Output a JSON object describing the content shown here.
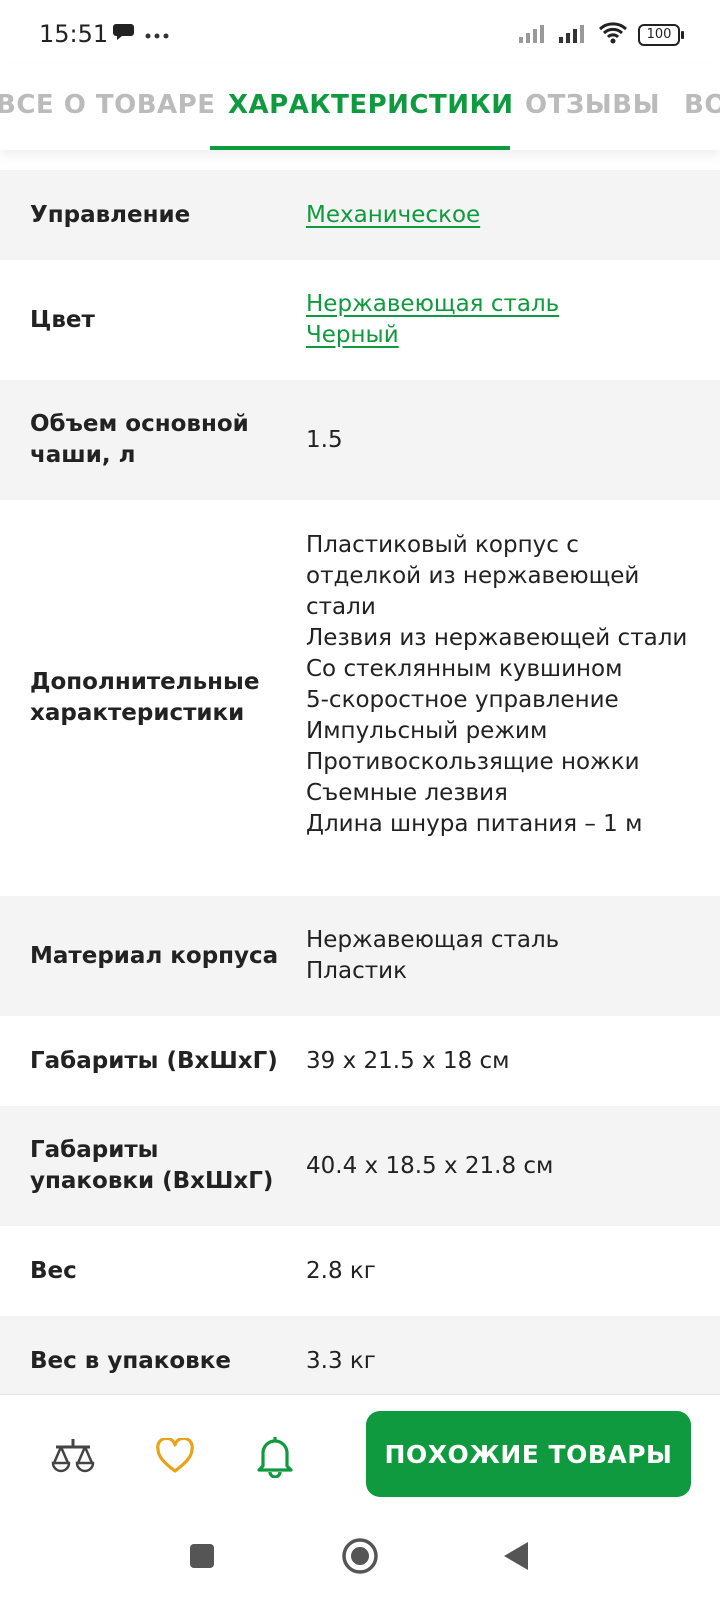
{
  "status_bar": {
    "time": "15:51",
    "battery": "100",
    "icons": [
      "chat-bubble-icon",
      "more-dots-icon",
      "signal-icon",
      "signal-icon",
      "wifi-icon",
      "battery-icon"
    ]
  },
  "tabs": [
    {
      "label": "ВСЕ О ТОВАРЕ",
      "active": false
    },
    {
      "label": "ХАРАКТЕРИСТИКИ",
      "active": true
    },
    {
      "label": "ОТЗЫВЫ",
      "active": false
    },
    {
      "label": "ВО",
      "active": false
    }
  ],
  "specs": [
    {
      "key": "Управление",
      "values": [
        "Механическое"
      ],
      "link": true
    },
    {
      "key": "Цвет",
      "values": [
        "Нержавеющая сталь",
        "Черный"
      ],
      "link": true
    },
    {
      "key": "Объем основной чаши, л",
      "values": [
        "1.5"
      ],
      "link": false
    },
    {
      "key": "Дополнительные характеристики",
      "values": [
        "Пластиковый корпус с отделкой из нержавеющей стали",
        "Лезвия из нержавеющей стали",
        "Со стеклянным кувшином",
        "5-скоростное управление",
        "Импульсный режим",
        "Противоскользящие ножки",
        "Съемные лезвия",
        "Длина шнура питания – 1 м"
      ],
      "link": false
    },
    {
      "key": "Материал корпуса",
      "values": [
        "Нержавеющая сталь",
        "Пластик"
      ],
      "link": false
    },
    {
      "key": "Габариты (ВхШхГ)",
      "values": [
        "39 x 21.5 x 18 см"
      ],
      "link": false
    },
    {
      "key": "Габариты упаковки (ВхШхГ)",
      "values": [
        "40.4 x 18.5 x 21.8 см"
      ],
      "link": false
    },
    {
      "key": "Вес",
      "values": [
        "2.8 кг"
      ],
      "link": false
    },
    {
      "key": "Вес в упаковке",
      "values": [
        "3.3 кг"
      ],
      "link": false
    }
  ],
  "bottom_bar": {
    "icons": [
      "compare-scales-icon",
      "favorite-heart-icon",
      "notify-bell-icon"
    ],
    "similar_button": "ПОХОЖИЕ ТОВАРЫ"
  },
  "colors": {
    "accent": "#109a3f",
    "heart": "#e8a317",
    "shade_row": "#f4f4f4"
  },
  "nav_bar": {
    "icons": [
      "recents-square-icon",
      "home-circle-icon",
      "back-triangle-icon"
    ]
  }
}
